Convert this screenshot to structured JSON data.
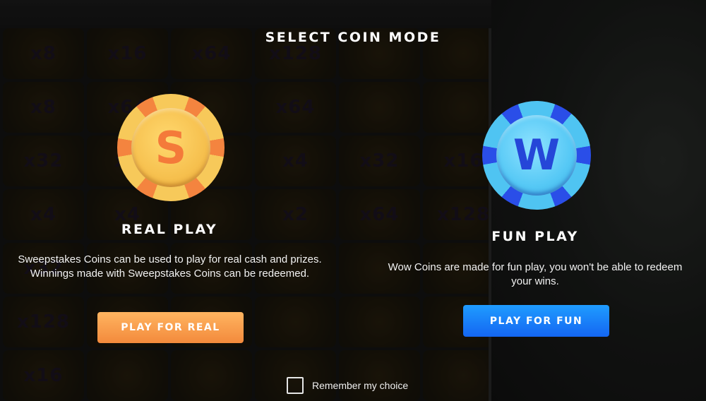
{
  "background": {
    "cells": [
      "x8",
      "x16",
      "x64",
      "x128",
      "",
      "",
      "x8",
      "x64",
      "",
      "x64",
      "",
      "",
      "x32",
      "x8",
      "",
      "x4",
      "x32",
      "x16",
      "x4",
      "x4",
      "",
      "x2",
      "x64",
      "x128",
      "x32",
      "",
      "",
      "",
      "",
      "",
      "x128",
      "",
      "",
      "",
      "",
      "",
      "x16",
      "",
      "",
      "",
      "",
      ""
    ]
  },
  "modal": {
    "title": "SELECT COIN MODE",
    "real": {
      "coin_letter": "S",
      "title": "REAL PLAY",
      "description": "Sweepstakes Coins can be used to play for real cash and prizes. Winnings made with Sweepstakes Coins can be redeemed.",
      "button_label": "PLAY FOR REAL",
      "accent": "#f38a3c"
    },
    "fun": {
      "coin_letter": "W",
      "title": "FUN PLAY",
      "description": "Wow Coins are made for fun play, you won't be able to redeem your wins.",
      "button_label": "PLAY FOR FUN",
      "accent": "#1466f2"
    },
    "remember_label": "Remember my choice",
    "remember_checked": false
  }
}
